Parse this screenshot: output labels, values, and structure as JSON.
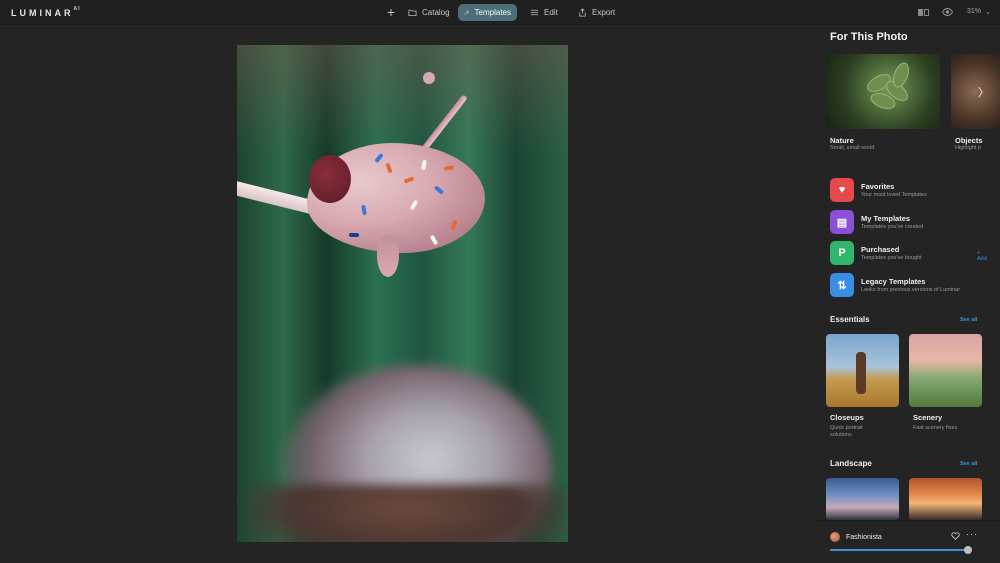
{
  "app": {
    "logo": "LUMINAR",
    "logo_sup": "AI"
  },
  "toolbar": {
    "add_label": "+",
    "tabs": [
      {
        "label": "Catalog",
        "icon": "folder-icon"
      },
      {
        "label": "Templates",
        "icon": "templates-icon",
        "active": true
      },
      {
        "label": "Edit",
        "icon": "sliders-icon"
      },
      {
        "label": "Export",
        "icon": "share-icon"
      }
    ],
    "zoom": "31%",
    "zoom_chevron": "⌄"
  },
  "panel": {
    "title": "For This Photo",
    "featured": [
      {
        "title": "Nature",
        "subtitle": "Small, small world"
      },
      {
        "title": "Objects",
        "subtitle": "Highlight p"
      }
    ],
    "next_arrow": "〉",
    "collections": [
      {
        "name": "Favorites",
        "desc": "Your most loved Templates",
        "icon": "heart-icon",
        "color": "#e5484d",
        "glyph": "♥"
      },
      {
        "name": "My Templates",
        "desc": "Templates you've created",
        "icon": "template-list-icon",
        "color": "#8b4fd8",
        "glyph": "▤"
      },
      {
        "name": "Purchased",
        "desc": "Templates you've bought",
        "icon": "purchase-icon",
        "color": "#2fb66b",
        "glyph": "P",
        "action": "+ Add"
      },
      {
        "name": "Legacy Templates",
        "desc": "Looks from previous versions of Luminar",
        "icon": "legacy-icon",
        "color": "#3a8ee6",
        "glyph": "⇅"
      }
    ],
    "essentials": {
      "title": "Essentials",
      "see_all": "See all",
      "items": [
        {
          "title": "Closeups",
          "subtitle_1": "Quick portrait",
          "subtitle_2": "solutions"
        },
        {
          "title": "Scenery",
          "subtitle_1": "Fast scenery fixes",
          "subtitle_2": ""
        }
      ]
    },
    "landscape": {
      "title": "Landscape",
      "see_all": "See all"
    }
  },
  "applied": {
    "name": "Fashionista",
    "more": "···",
    "amount_fraction": 0.95
  },
  "colors": {
    "accent": "#3f90e0",
    "active_tab": "#4c6f78"
  }
}
